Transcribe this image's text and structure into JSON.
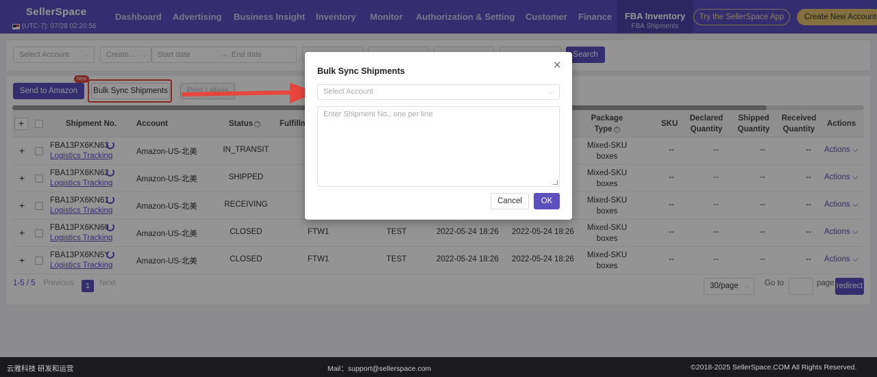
{
  "header": {
    "logo": "SellerSpace",
    "timezone": "(UTC-7): 07/28 02:20:56",
    "nav": [
      "Dashboard",
      "Advertising",
      "Business Insight",
      "Inventory",
      "Monitor",
      "Authorization & Setting",
      "Customer",
      "Finance"
    ],
    "active_nav": {
      "label": "FBA Inventory",
      "sub": "FBA Shipments"
    },
    "try_app": "Try the SellerSpace App",
    "create_account": "Create New Account"
  },
  "filters": {
    "select_account": "Select Account",
    "create": "Create...",
    "start_date": "Start date",
    "date_sep": "→",
    "end_date": "End date",
    "search": "Search"
  },
  "toolbar": {
    "send_to_amazon": "Send to Amazon",
    "new_badge": "New",
    "bulk_sync": "Bulk Sync Shipments",
    "print_labels": "Print Labels"
  },
  "table": {
    "headers": {
      "shipment_no": "Shipment No.",
      "account": "Account",
      "status": "Status",
      "fulfillment": "Fulfillm",
      "package_type_1": "Package",
      "package_type_2": "Type",
      "sku": "SKU",
      "declared_1": "Declared",
      "declared_2": "Quantity",
      "shipped_1": "Shipped",
      "shipped_2": "Quantity",
      "received_1": "Received",
      "received_2": "Quantity",
      "actions": "Actions"
    },
    "rows": [
      {
        "shipment_no": "FBA13PX6KN63",
        "tracking": "Logistics Tracking",
        "account": "Amazon-US-北美",
        "status": "IN_TRANSIT",
        "fc": "",
        "name": "",
        "created": "",
        "updated": "",
        "pkg1": "Mixed-SKU",
        "pkg2": "boxes",
        "sku": "--",
        "declared": "--",
        "shipped": "--",
        "received": "--",
        "actions": "Actions"
      },
      {
        "shipment_no": "FBA13PX6KN62",
        "tracking": "Logistics Tracking",
        "account": "Amazon-US-北美",
        "status": "SHIPPED",
        "fc": "",
        "name": "",
        "created": "",
        "updated": "",
        "pkg1": "Mixed-SKU",
        "pkg2": "boxes",
        "sku": "--",
        "declared": "--",
        "shipped": "--",
        "received": "--",
        "actions": "Actions"
      },
      {
        "shipment_no": "FBA13PX6KN61",
        "tracking": "Logistics Tracking",
        "account": "Amazon-US-北美",
        "status": "RECEIVING",
        "fc": "",
        "name": "",
        "created": "",
        "updated": "",
        "pkg1": "Mixed-SKU",
        "pkg2": "boxes",
        "sku": "--",
        "declared": "--",
        "shipped": "--",
        "received": "--",
        "actions": "Actions"
      },
      {
        "shipment_no": "FBA13PX6KN60",
        "tracking": "Logistics Tracking",
        "account": "Amazon-US-北美",
        "status": "CLOSED",
        "fc": "FTW1",
        "name": "TEST",
        "created": "2022-05-24 18:26",
        "updated": "2022-05-24 18:26",
        "pkg1": "Mixed-SKU",
        "pkg2": "boxes",
        "sku": "--",
        "declared": "--",
        "shipped": "--",
        "received": "--",
        "actions": "Actions"
      },
      {
        "shipment_no": "FBA13PX6KN5Y",
        "tracking": "Logistics Tracking",
        "account": "Amazon-US-北美",
        "status": "CLOSED",
        "fc": "FTW1",
        "name": "TEST",
        "created": "2022-05-24 18:26",
        "updated": "2022-05-24 18:26",
        "pkg1": "Mixed-SKU",
        "pkg2": "boxes",
        "sku": "--",
        "declared": "--",
        "shipped": "--",
        "received": "--",
        "actions": "Actions"
      }
    ]
  },
  "pagination": {
    "range": "1-5",
    "total": "5",
    "previous": "Previous",
    "page": "1",
    "next": "Next",
    "per_page": "30/page",
    "goto": "Go to",
    "page_label": "page",
    "redirect": "redirect"
  },
  "modal": {
    "title": "Bulk Sync Shipments",
    "select_placeholder": "Select Account",
    "textarea_placeholder": "Enter Shipment No., one per line",
    "cancel": "Cancel",
    "ok": "OK"
  },
  "footer": {
    "left": "云雅科技 研发和运营",
    "mail": "Mail：support@sellerspace.com",
    "copyright": "©2018-2025 SellerSpace.COM All Rights Reserved."
  },
  "colors": {
    "brand": "#5b4fbf",
    "accent_gold": "#e2c06f",
    "highlight": "#e8453c"
  }
}
